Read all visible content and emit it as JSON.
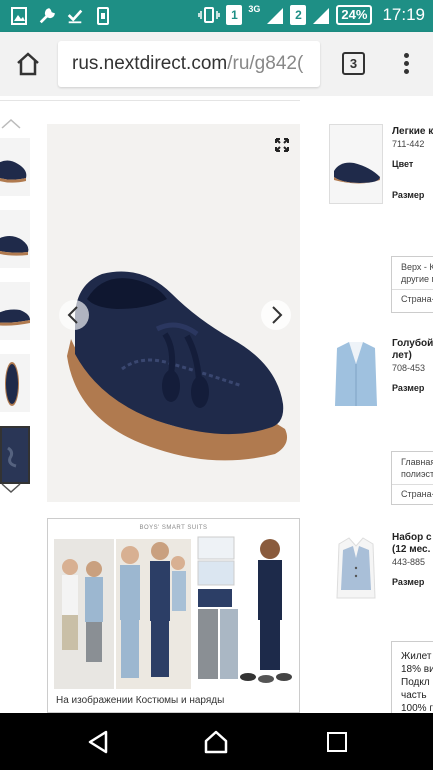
{
  "status_bar": {
    "sim1": "1",
    "sim2": "2",
    "network_type": "3G",
    "battery": "24%",
    "time": "17:19"
  },
  "browser": {
    "url_domain": "rus.nextdirect.com",
    "url_path": "/ru/g842(",
    "tab_count": "3"
  },
  "product_gallery": {
    "banner_title": "BOYS' SMART SUITS",
    "banner_caption": "На изображении Костюмы и наряды"
  },
  "products": [
    {
      "title_line1": "Легкие к",
      "code": "711-442",
      "color_label": "Цвет",
      "size_label": "Размер",
      "info_line1": "Верх - К",
      "info_line2": "другие м",
      "info_line3": "Страна-"
    },
    {
      "title_line1": "Голубой",
      "title_line2": "лет)",
      "code": "708-453",
      "size_label": "Размер",
      "info_line1": "Главная",
      "info_line2": "полиэст",
      "info_line3": "Страна-"
    },
    {
      "title_line1": "Набор с",
      "title_line2": "(12 мес.",
      "code": "443-885",
      "size_label": "Размер",
      "info_line1": "Жилет",
      "info_line2": "18% ви",
      "info_line3": "Подкл",
      "info_line4": "часть",
      "info_line5": "100% г"
    }
  ],
  "colors": {
    "status_bar": "#1e8f85",
    "shoe": "#1f2a4a",
    "sole": "#b07a4f"
  }
}
